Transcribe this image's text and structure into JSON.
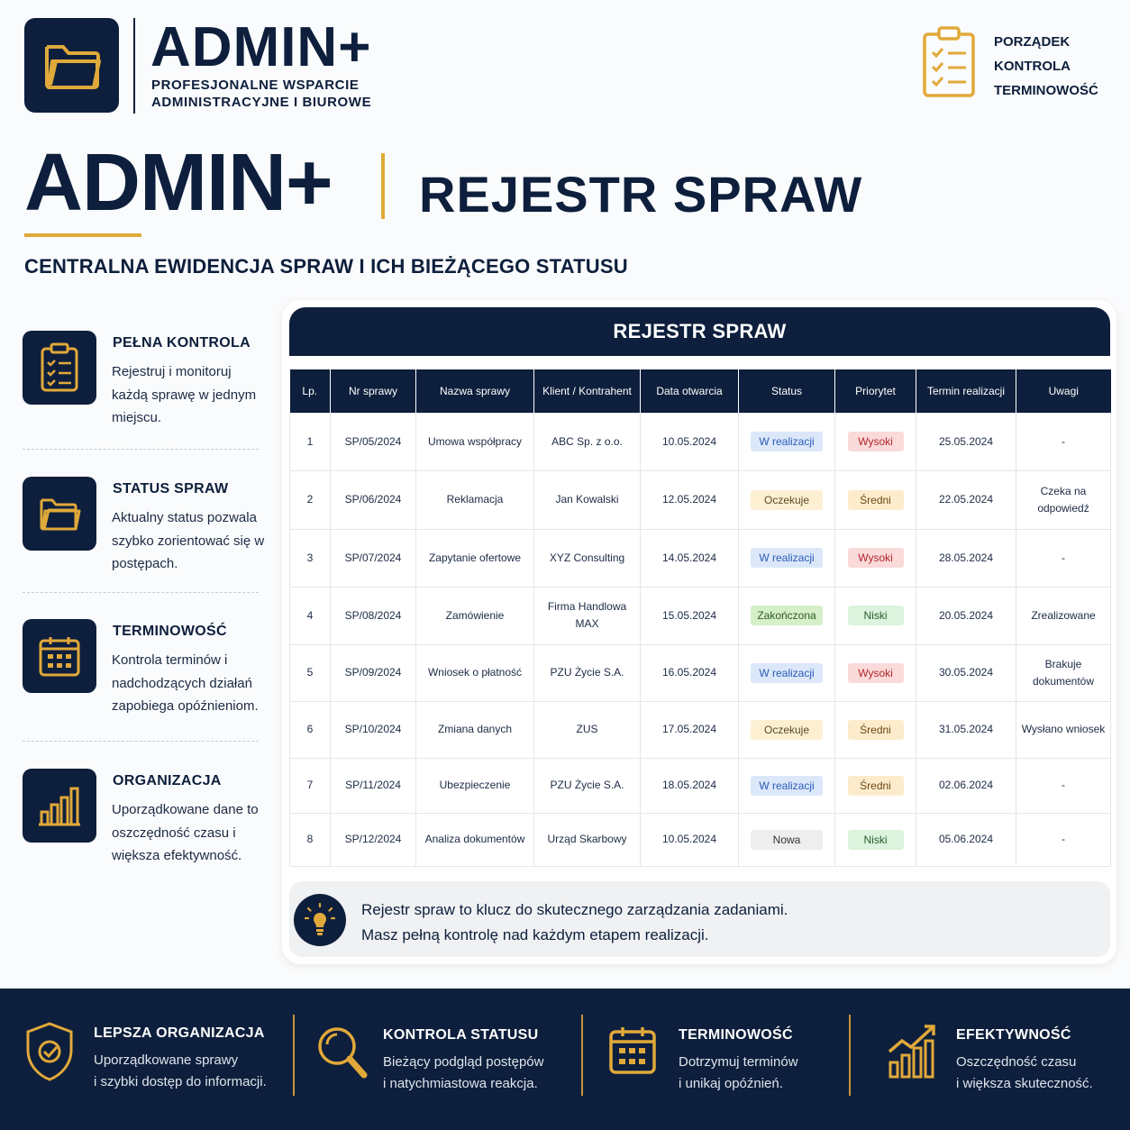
{
  "header": {
    "brand": "ADMIN+",
    "brand_sub_line1": "PROFESJONALNE WSPARCIE",
    "brand_sub_line2": "ADMINISTRACYJNE I BIUROWE",
    "right_items": [
      "PORZĄDEK",
      "KONTROLA",
      "TERMINOWOŚĆ"
    ]
  },
  "hero": {
    "title": "ADMIN+",
    "subtitle": "REJESTR SPRAW",
    "tagline": "CENTRALNA EWIDENCJA SPRAW I ICH BIEŻĄCEGO STATUSU"
  },
  "features": [
    {
      "title": "PEŁNA KONTROLA",
      "text": "Rejestruj i monitoruj każdą sprawę w jednym miejscu.",
      "icon": "clipboard-icon"
    },
    {
      "title": "STATUS SPRAW",
      "text": "Aktualny status pozwala szybko zorientować się w postępach.",
      "icon": "folder-icon"
    },
    {
      "title": "TERMINOWOŚĆ",
      "text": "Kontrola terminów i nadchodzących działań zapobiega opóźnieniom.",
      "icon": "calendar-icon"
    },
    {
      "title": "ORGANIZACJA",
      "text": "Uporządkowane dane to oszczędność czasu i większa efektywność.",
      "icon": "bar-chart-icon"
    }
  ],
  "register": {
    "title": "REJESTR SPRAW",
    "columns": [
      "Lp.",
      "Nr sprawy",
      "Nazwa sprawy",
      "Klient / Kontrahent",
      "Data otwarcia",
      "Status",
      "Priorytet",
      "Termin realizacji",
      "Uwagi"
    ],
    "rows": [
      {
        "lp": "1",
        "nr": "SP/05/2024",
        "nazwa": "Umowa współpracy",
        "klient": "ABC Sp. z o.o.",
        "data": "10.05.2024",
        "status": "W realizacji",
        "priorytet": "Wysoki",
        "termin": "25.05.2024",
        "uwagi": "-"
      },
      {
        "lp": "2",
        "nr": "SP/06/2024",
        "nazwa": "Reklamacja",
        "klient": "Jan Kowalski",
        "data": "12.05.2024",
        "status": "Oczekuje",
        "priorytet": "Średni",
        "termin": "22.05.2024",
        "uwagi": "Czeka na odpowiedź"
      },
      {
        "lp": "3",
        "nr": "SP/07/2024",
        "nazwa": "Zapytanie ofertowe",
        "klient": "XYZ Consulting",
        "data": "14.05.2024",
        "status": "W realizacji",
        "priorytet": "Wysoki",
        "termin": "28.05.2024",
        "uwagi": "-"
      },
      {
        "lp": "4",
        "nr": "SP/08/2024",
        "nazwa": "Zamówienie",
        "klient": "Firma Handlowa MAX",
        "data": "15.05.2024",
        "status": "Zakończona",
        "priorytet": "Niski",
        "termin": "20.05.2024",
        "uwagi": "Zrealizowane"
      },
      {
        "lp": "5",
        "nr": "SP/09/2024",
        "nazwa": "Wniosek o płatność",
        "klient": "PZU Życie S.A.",
        "data": "16.05.2024",
        "status": "W realizacji",
        "priorytet": "Wysoki",
        "termin": "30.05.2024",
        "uwagi": "Brakuje dokumentów"
      },
      {
        "lp": "6",
        "nr": "SP/10/2024",
        "nazwa": "Zmiana danych",
        "klient": "ZUS",
        "data": "17.05.2024",
        "status": "Oczekuje",
        "priorytet": "Średni",
        "termin": "31.05.2024",
        "uwagi": "Wysłano wniosek"
      },
      {
        "lp": "7",
        "nr": "SP/11/2024",
        "nazwa": "Ubezpieczenie",
        "klient": "PZU Życie S.A.",
        "data": "18.05.2024",
        "status": "W realizacji",
        "priorytet": "Średni",
        "termin": "02.06.2024",
        "uwagi": "-"
      },
      {
        "lp": "8",
        "nr": "SP/12/2024",
        "nazwa": "Analiza dokumentów",
        "klient": "Urząd Skarbowy",
        "data": "10.05.2024",
        "status": "Nowa",
        "priorytet": "Niski",
        "termin": "05.06.2024",
        "uwagi": "-"
      }
    ],
    "status_colors": {
      "W realizacji": {
        "bg": "#dce8fa",
        "fg": "#2a5bb5"
      },
      "Oczekuje": {
        "bg": "#fdf0d2",
        "fg": "#5a4a22"
      },
      "Zakończona": {
        "bg": "#d5efc9",
        "fg": "#2f5a21"
      },
      "Nowa": {
        "bg": "#eeeeee",
        "fg": "#333333"
      }
    },
    "priority_colors": {
      "Wysoki": {
        "bg": "#fbdada",
        "fg": "#b1262a"
      },
      "Średni": {
        "bg": "#fdeccc",
        "fg": "#6b4a12"
      },
      "Niski": {
        "bg": "#dcf3dd",
        "fg": "#2c5a2e"
      }
    }
  },
  "info": {
    "line1": "Rejestr spraw to klucz do skutecznego zarządzania zadaniami.",
    "line2": "Masz pełną kontrolę nad każdym etapem realizacji."
  },
  "footer": [
    {
      "title": "LEPSZA ORGANIZACJA",
      "line1": "Uporządkowane sprawy",
      "line2": "i szybki dostęp do informacji.",
      "icon": "shield-check-icon"
    },
    {
      "title": "KONTROLA STATUSU",
      "line1": "Bieżący podgląd postępów",
      "line2": "i natychmiastowa reakcja.",
      "icon": "magnifier-icon"
    },
    {
      "title": "TERMINOWOŚĆ",
      "line1": "Dotrzymuj terminów",
      "line2": "i unikaj opóźnień.",
      "icon": "calendar-icon"
    },
    {
      "title": "EFEKTYWNOŚĆ",
      "line1": "Oszczędność czasu",
      "line2": "i większa skuteczność.",
      "icon": "growth-chart-icon"
    }
  ],
  "colors": {
    "navy": "#0d1f3c",
    "gold": "#e1a93a"
  }
}
